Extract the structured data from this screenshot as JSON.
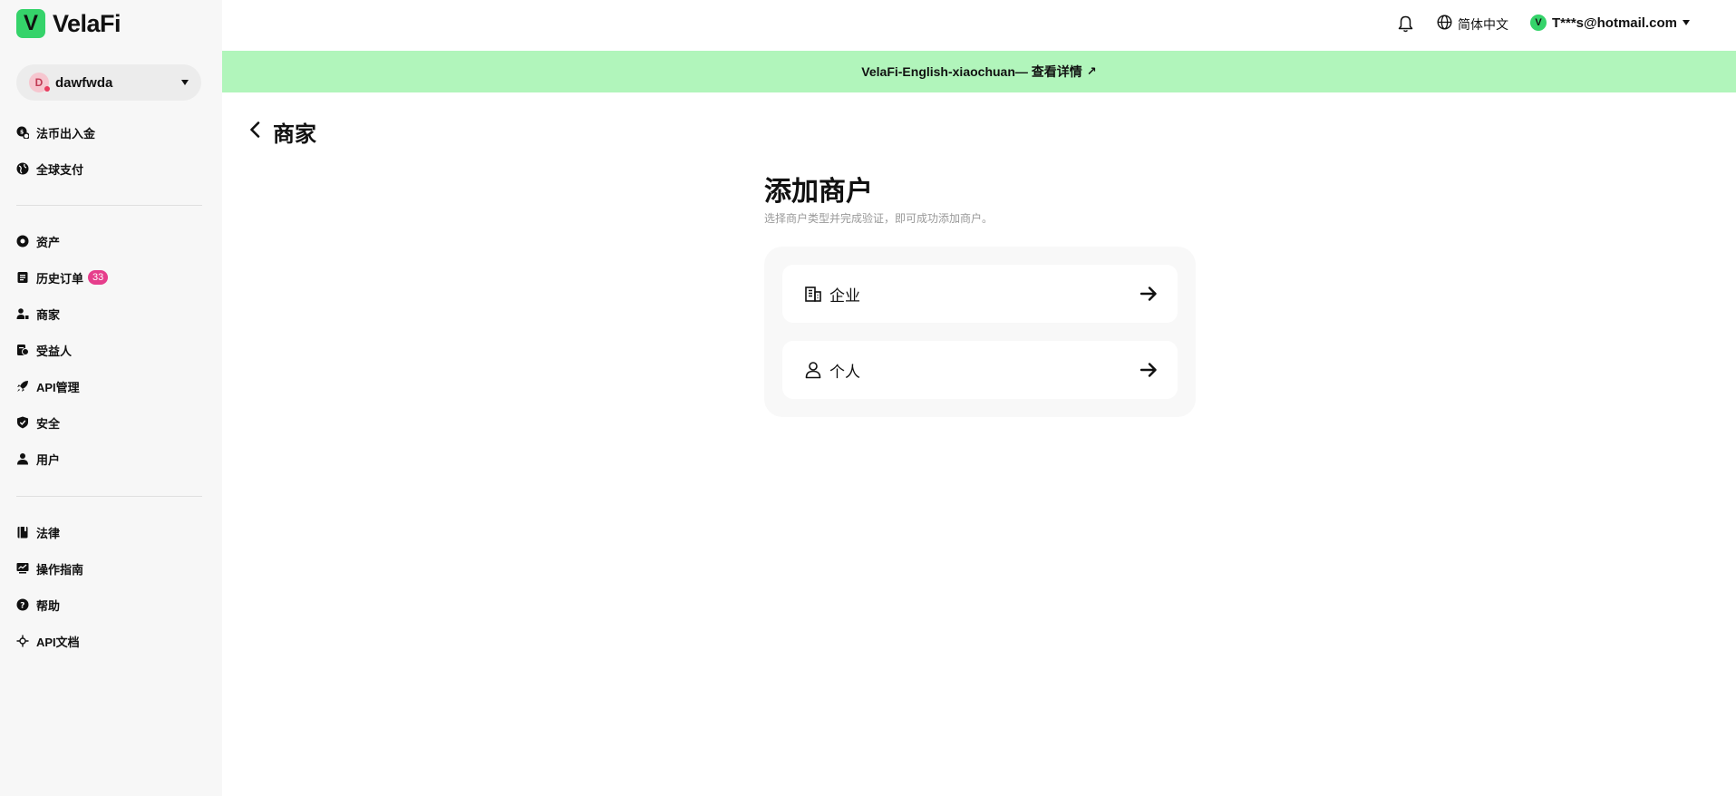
{
  "app": {
    "logo_letter": "V",
    "name": "VelaFi"
  },
  "account": {
    "avatar_letter": "D",
    "name": "dawfwda"
  },
  "sidebar": {
    "group1": [
      {
        "label": "法币出入金",
        "icon": "fiat-exchange-icon"
      },
      {
        "label": "全球支付",
        "icon": "globe-icon"
      }
    ],
    "group2": [
      {
        "label": "资产",
        "icon": "coin-icon"
      },
      {
        "label": "历史订单",
        "icon": "orders-icon",
        "badge": "33"
      },
      {
        "label": "商家",
        "icon": "merchant-icon"
      },
      {
        "label": "受益人",
        "icon": "beneficiary-icon"
      },
      {
        "label": "API管理",
        "icon": "rocket-icon"
      },
      {
        "label": "安全",
        "icon": "shield-icon"
      },
      {
        "label": "用户",
        "icon": "user-icon"
      }
    ],
    "group3": [
      {
        "label": "法律",
        "icon": "book-icon"
      },
      {
        "label": "操作指南",
        "icon": "presentation-icon"
      },
      {
        "label": "帮助",
        "icon": "help-icon"
      },
      {
        "label": "API文档",
        "icon": "api-docs-icon"
      }
    ]
  },
  "topbar": {
    "language": "简体中文",
    "user_avatar_letter": "V",
    "user_email": "T***s@hotmail.com"
  },
  "banner": {
    "text": "VelaFi-English-xiaochuan— 查看详情",
    "arrow": "↗"
  },
  "page": {
    "back_title": "商家",
    "heading": "添加商户",
    "subheading": "选择商户类型并完成验证，即可成功添加商户。",
    "options": [
      {
        "label": "企业",
        "icon": "building-icon"
      },
      {
        "label": "个人",
        "icon": "person-icon"
      }
    ]
  },
  "colors": {
    "brand": "#35d36a",
    "banner": "#b1f5bb",
    "badge": "#e63e8c",
    "sidebar_bg": "#f7f7f7"
  }
}
